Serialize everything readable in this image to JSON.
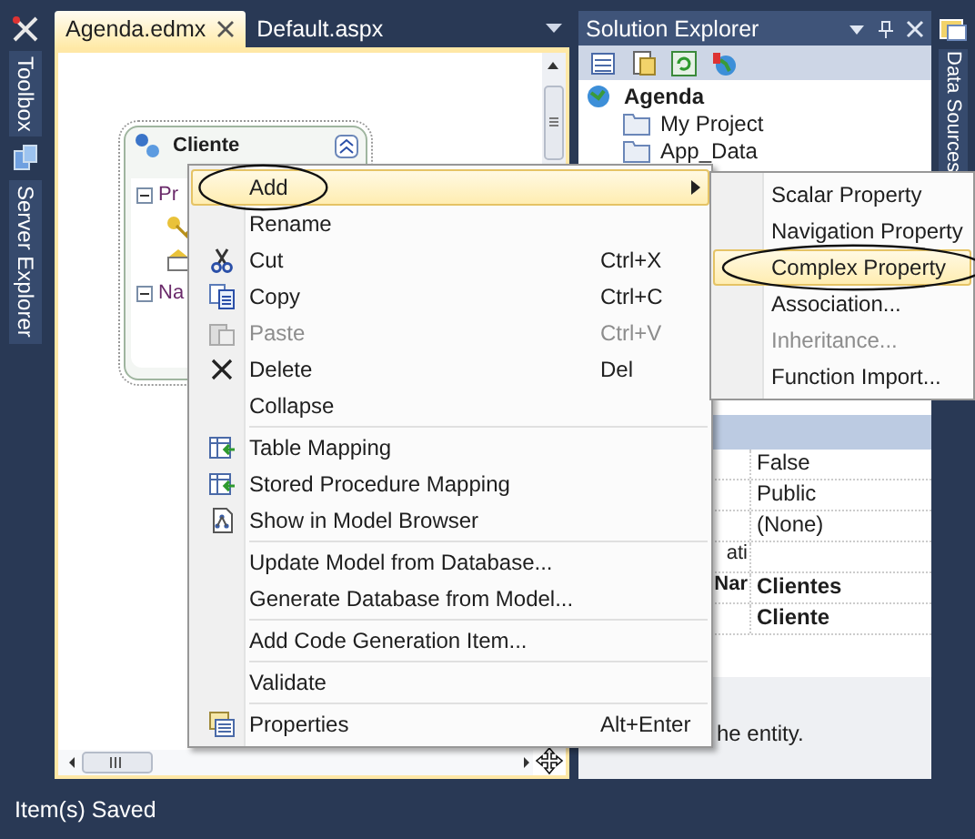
{
  "left_rail": {
    "tabs": [
      {
        "label": "Toolbox",
        "kind": "toolbox"
      },
      {
        "label": "Server Explorer",
        "kind": "server"
      }
    ]
  },
  "document_tabs": [
    {
      "label": "Agenda.edmx",
      "selected": true
    },
    {
      "label": "Default.aspx",
      "selected": false
    }
  ],
  "entity": {
    "title": "Cliente",
    "sections": [
      {
        "label": "Pr",
        "expanded": true,
        "properties": [
          {
            "kind": "key"
          },
          {
            "kind": "scalar"
          }
        ]
      },
      {
        "label": "Na",
        "expanded": true
      }
    ]
  },
  "context_menu": {
    "items": [
      {
        "kind": "plain",
        "label": "Add",
        "selected": true,
        "disabled": false,
        "submenu": true,
        "circled": true
      },
      {
        "kind": "plain",
        "label": "Rename",
        "selected": false,
        "disabled": false,
        "submenu": false,
        "circled": false
      },
      {
        "kind": "cut",
        "label": "Cut",
        "shortcut": "Ctrl+X",
        "selected": false,
        "disabled": false,
        "submenu": false,
        "circled": false
      },
      {
        "kind": "copy",
        "label": "Copy",
        "shortcut": "Ctrl+C",
        "selected": false,
        "disabled": false,
        "submenu": false,
        "circled": false
      },
      {
        "kind": "paste",
        "label": "Paste",
        "shortcut": "Ctrl+V",
        "selected": false,
        "disabled": true,
        "submenu": false,
        "circled": false
      },
      {
        "kind": "delete",
        "label": "Delete",
        "shortcut": "Del",
        "selected": false,
        "disabled": false,
        "submenu": false,
        "circled": false
      },
      {
        "kind": "plain",
        "label": "Collapse",
        "selected": false,
        "disabled": false,
        "submenu": false,
        "circled": false
      },
      {
        "kind": "separator"
      },
      {
        "kind": "mapping",
        "label": "Table Mapping",
        "selected": false,
        "disabled": false,
        "submenu": false,
        "circled": false
      },
      {
        "kind": "mapping",
        "label": "Stored Procedure Mapping",
        "selected": false,
        "disabled": false,
        "submenu": false,
        "circled": false
      },
      {
        "kind": "browser",
        "label": "Show in Model Browser",
        "selected": false,
        "disabled": false,
        "submenu": false,
        "circled": false
      },
      {
        "kind": "separator"
      },
      {
        "kind": "plain",
        "label": "Update Model from Database...",
        "selected": false,
        "disabled": false,
        "submenu": false,
        "circled": false
      },
      {
        "kind": "plain",
        "label": "Generate Database from Model...",
        "selected": false,
        "disabled": false,
        "submenu": false,
        "circled": false
      },
      {
        "kind": "separator"
      },
      {
        "kind": "plain",
        "label": "Add Code Generation Item...",
        "selected": false,
        "disabled": false,
        "submenu": false,
        "circled": false
      },
      {
        "kind": "separator"
      },
      {
        "kind": "plain",
        "label": "Validate",
        "selected": false,
        "disabled": false,
        "submenu": false,
        "circled": false
      },
      {
        "kind": "separator"
      },
      {
        "kind": "properties",
        "label": "Properties",
        "shortcut": "Alt+Enter",
        "selected": false,
        "disabled": false,
        "submenu": false,
        "circled": false
      }
    ]
  },
  "submenu": {
    "items": [
      {
        "label": "Scalar Property",
        "selected": false,
        "disabled": false,
        "circled": false
      },
      {
        "label": "Navigation Property",
        "selected": false,
        "disabled": false,
        "circled": false
      },
      {
        "label": "Complex Property",
        "selected": true,
        "disabled": false,
        "circled": true
      },
      {
        "label": "Association...",
        "selected": false,
        "disabled": false,
        "circled": false
      },
      {
        "label": "Inheritance...",
        "selected": false,
        "disabled": true,
        "circled": false
      },
      {
        "label": "Function Import...",
        "selected": false,
        "disabled": false,
        "circled": false
      }
    ]
  },
  "solution_explorer": {
    "title": "Solution Explorer",
    "tree": [
      {
        "label": "Agenda",
        "children": [
          {
            "label": "My Project"
          },
          {
            "label": "App_Data"
          }
        ]
      }
    ]
  },
  "properties": {
    "rows": [
      {
        "value": "False",
        "modified": false
      },
      {
        "value": "Public",
        "modified": false
      },
      {
        "value": "(None)",
        "modified": false
      },
      {
        "name": "ati",
        "modified": false
      },
      {
        "name": "Nar",
        "value": "Clientes",
        "modified": true
      },
      {
        "value": "Cliente",
        "modified": true
      }
    ],
    "description": "he entity."
  },
  "right_rail": {
    "tabs": [
      {
        "label": "Data Sources"
      }
    ]
  },
  "status_bar": {
    "text": "Item(s) Saved"
  }
}
